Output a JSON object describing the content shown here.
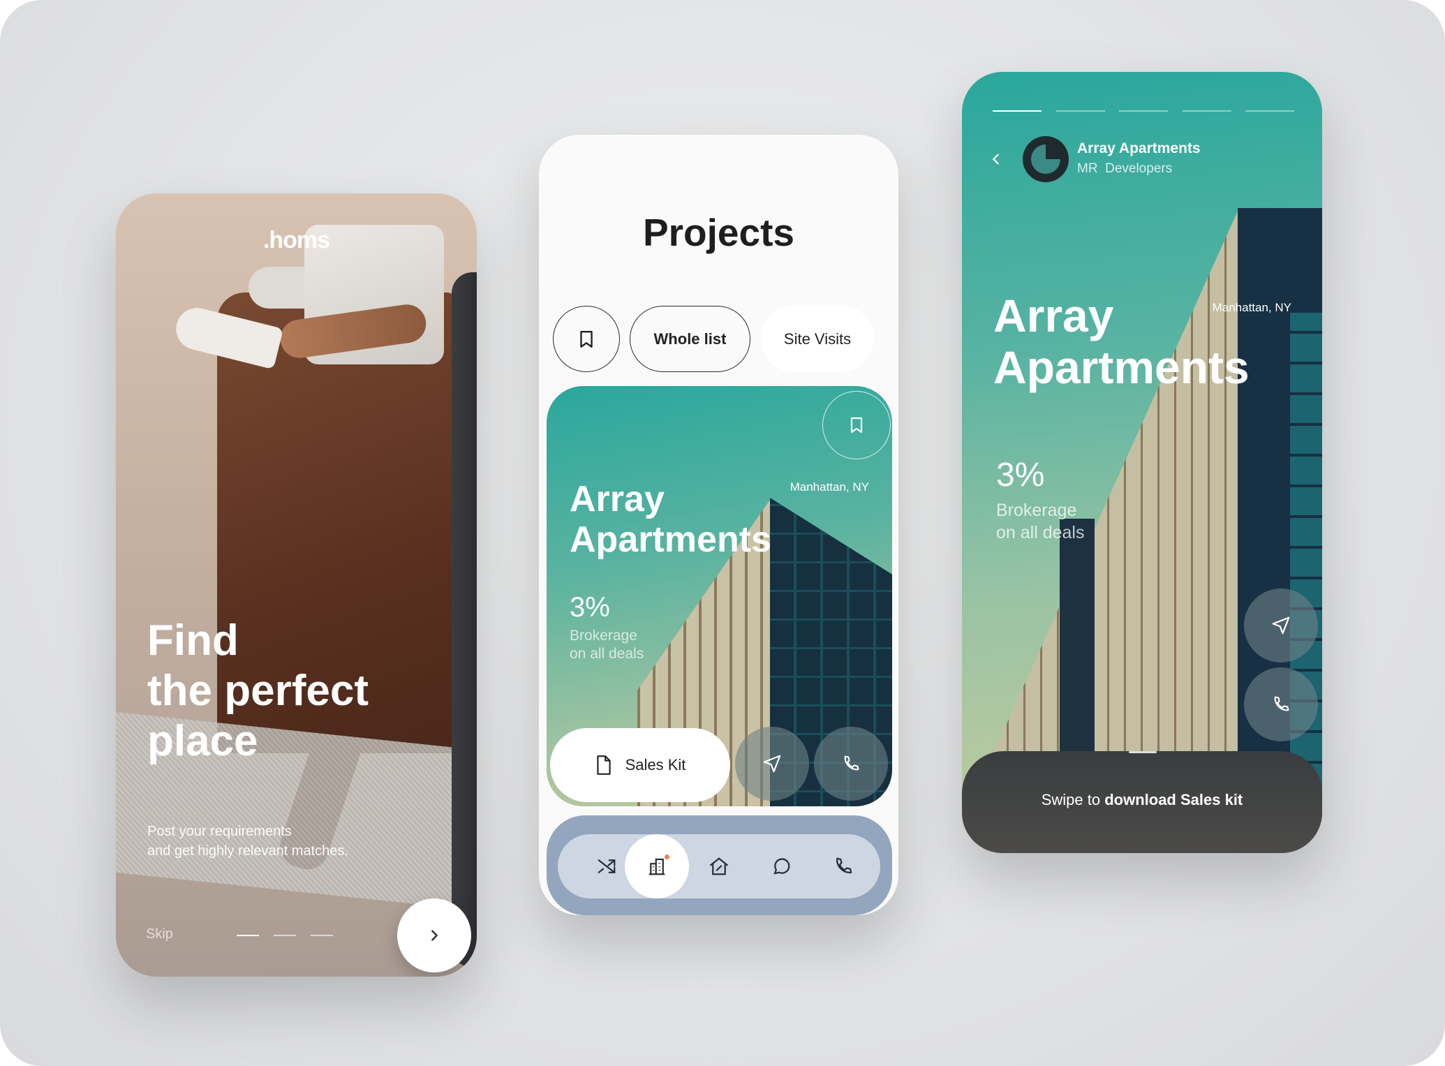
{
  "onboarding": {
    "logo": ".homs",
    "headline_lines": [
      "Find",
      "the perfect",
      "place"
    ],
    "subtitle_lines": [
      "Post your requirements",
      "and get highly relevant matches."
    ],
    "skip_label": "Skip",
    "page_count": 3,
    "active_page": 1,
    "next_icon": "chevron-right-icon"
  },
  "projects": {
    "title": "Projects",
    "filters": [
      {
        "icon": "bookmark-icon",
        "label": ""
      },
      {
        "label": "Whole list",
        "selected": true
      },
      {
        "label": "Site Visits",
        "selected": false
      }
    ],
    "card": {
      "location": "Manhattan, NY",
      "name_lines": [
        "Array",
        "Apartments"
      ],
      "brokerage": "3%",
      "brokerage_lines": [
        "Brokerage",
        "on all deals"
      ],
      "sales_kit_label": "Sales Kit",
      "icons": [
        "bookmark-icon",
        "document-icon",
        "send-icon",
        "phone-icon"
      ]
    },
    "nav": [
      {
        "icon": "shuffle-icon"
      },
      {
        "icon": "building-icon",
        "active": true,
        "badge_color": "#e8845a"
      },
      {
        "icon": "home-percent-icon"
      },
      {
        "icon": "chat-icon"
      },
      {
        "icon": "phone-icon"
      }
    ]
  },
  "detail": {
    "story_segments": 5,
    "active_segment": 1,
    "header_title": "Array Apartments",
    "header_subtitle": "MR  Developers",
    "location": "Manhattan, NY",
    "name_lines": [
      "Array",
      "Apartments"
    ],
    "brokerage": "3%",
    "brokerage_lines": [
      "Brokerage",
      "on all deals"
    ],
    "swipe_prefix": "Swipe to ",
    "swipe_bold": "download Sales kit"
  },
  "colors": {
    "teal": "#2aa79d",
    "nav_bg": "#93a6bd",
    "dark": "#1e1e20"
  }
}
